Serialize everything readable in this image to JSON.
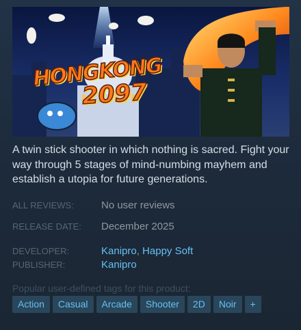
{
  "game": {
    "logo_line1": "HONGKONG",
    "logo_line2": "2097",
    "description": "A twin stick shooter in which nothing is sacred. Fight your way through 5 stages of mind-numbing mayhem and establish a utopia for future generations."
  },
  "details": {
    "reviews_label": "ALL REVIEWS:",
    "reviews_value": "No user reviews",
    "release_label": "RELEASE DATE:",
    "release_value": "December 2025",
    "developer_label": "DEVELOPER:",
    "developers": [
      "Kanipro",
      "Happy Soft"
    ],
    "developer_separator": ", ",
    "publisher_label": "PUBLISHER:",
    "publisher_value": "Kanipro"
  },
  "tags": {
    "heading": "Popular user-defined tags for this product:",
    "items": [
      "Action",
      "Casual",
      "Arcade",
      "Shooter",
      "2D",
      "Noir"
    ],
    "more_label": "+"
  },
  "colors": {
    "link": "#66c0f4",
    "label": "#556772",
    "value": "#8f98a0",
    "description": "#d6dee6"
  }
}
